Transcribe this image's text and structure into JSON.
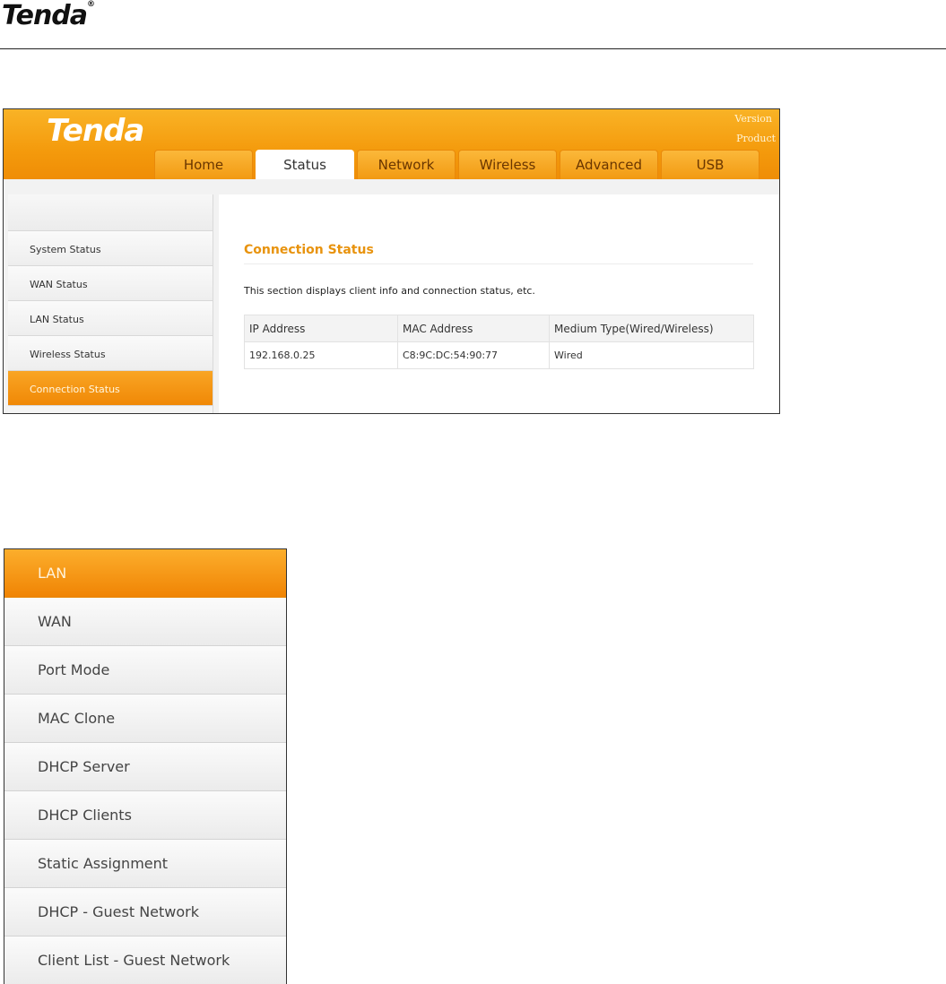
{
  "document": {
    "logo_text": "Tenda",
    "logo_reg": "®"
  },
  "router": {
    "logo": "Tenda",
    "version_label": "Version",
    "product_label": "Product !",
    "tabs": [
      "Home",
      "Status",
      "Network",
      "Wireless",
      "Advanced",
      "USB"
    ],
    "active_tab": "Status",
    "side_menu": [
      "System Status",
      "WAN Status",
      "LAN Status",
      "Wireless Status",
      "Connection Status"
    ],
    "active_side": "Connection Status",
    "content": {
      "title": "Connection Status",
      "description": "This section displays client info and connection status, etc.",
      "columns": [
        "IP Address",
        "MAC Address",
        "Medium Type(Wired/Wireless)"
      ],
      "rows": [
        [
          "192.168.0.25",
          "C8:9C:DC:54:90:77",
          "Wired"
        ]
      ]
    }
  },
  "network_menu": {
    "items": [
      "LAN",
      "WAN",
      "Port Mode",
      "MAC Clone",
      "DHCP Server",
      "DHCP Clients",
      "Static Assignment",
      "DHCP - Guest Network",
      "Client List - Guest Network"
    ],
    "active": "LAN"
  },
  "colors": {
    "accent_orange": "#f49a0c",
    "title_orange": "#e8930e"
  }
}
